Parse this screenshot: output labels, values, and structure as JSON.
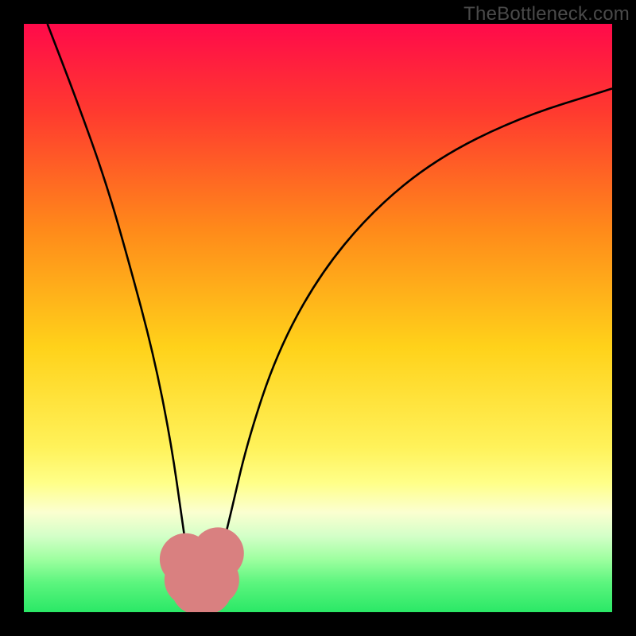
{
  "watermark": "TheBottleneck.com",
  "chart_data": {
    "type": "line",
    "title": "",
    "xlabel": "",
    "ylabel": "",
    "xlim": [
      0,
      100
    ],
    "ylim": [
      0,
      100
    ],
    "grid": false,
    "background_gradient": {
      "bands": [
        {
          "stop": 0,
          "color": "#ff0a4a"
        },
        {
          "stop": 15,
          "color": "#ff3a2f"
        },
        {
          "stop": 35,
          "color": "#ff8a1a"
        },
        {
          "stop": 55,
          "color": "#ffd21a"
        },
        {
          "stop": 72,
          "color": "#fff25a"
        },
        {
          "stop": 78,
          "color": "#ffff88"
        },
        {
          "stop": 83,
          "color": "#fbffd0"
        },
        {
          "stop": 87,
          "color": "#d4ffc8"
        },
        {
          "stop": 91,
          "color": "#9effa0"
        },
        {
          "stop": 95,
          "color": "#5cf57e"
        },
        {
          "stop": 100,
          "color": "#2ae866"
        }
      ]
    },
    "curve": {
      "description": "V-shaped bottleneck curve (two branches meeting at a flat minimum)",
      "x_at_minimum": 30,
      "minimum_span_x": [
        27,
        33
      ],
      "minimum_y": 4,
      "left_branch": [
        {
          "x": 4,
          "y": 100
        },
        {
          "x": 9,
          "y": 87
        },
        {
          "x": 14,
          "y": 73
        },
        {
          "x": 18,
          "y": 59
        },
        {
          "x": 22,
          "y": 44
        },
        {
          "x": 25,
          "y": 29
        },
        {
          "x": 27,
          "y": 15
        },
        {
          "x": 28,
          "y": 8
        },
        {
          "x": 29,
          "y": 5
        }
      ],
      "right_branch": [
        {
          "x": 32,
          "y": 5
        },
        {
          "x": 33,
          "y": 8
        },
        {
          "x": 35,
          "y": 16
        },
        {
          "x": 38,
          "y": 29
        },
        {
          "x": 43,
          "y": 44
        },
        {
          "x": 50,
          "y": 57
        },
        {
          "x": 59,
          "y": 68
        },
        {
          "x": 70,
          "y": 77
        },
        {
          "x": 84,
          "y": 84
        },
        {
          "x": 100,
          "y": 89
        }
      ]
    },
    "markers": [
      {
        "x": 27.5,
        "y": 9,
        "color": "#d98080",
        "r": 2.2
      },
      {
        "x": 28.3,
        "y": 5.5,
        "color": "#d98080",
        "r": 2.2
      },
      {
        "x": 29.5,
        "y": 4,
        "color": "#d98080",
        "r": 2.2
      },
      {
        "x": 31.0,
        "y": 4,
        "color": "#d98080",
        "r": 2.2
      },
      {
        "x": 32.2,
        "y": 5.5,
        "color": "#d98080",
        "r": 2.2
      },
      {
        "x": 33.0,
        "y": 10,
        "color": "#d98080",
        "r": 2.2
      }
    ]
  }
}
